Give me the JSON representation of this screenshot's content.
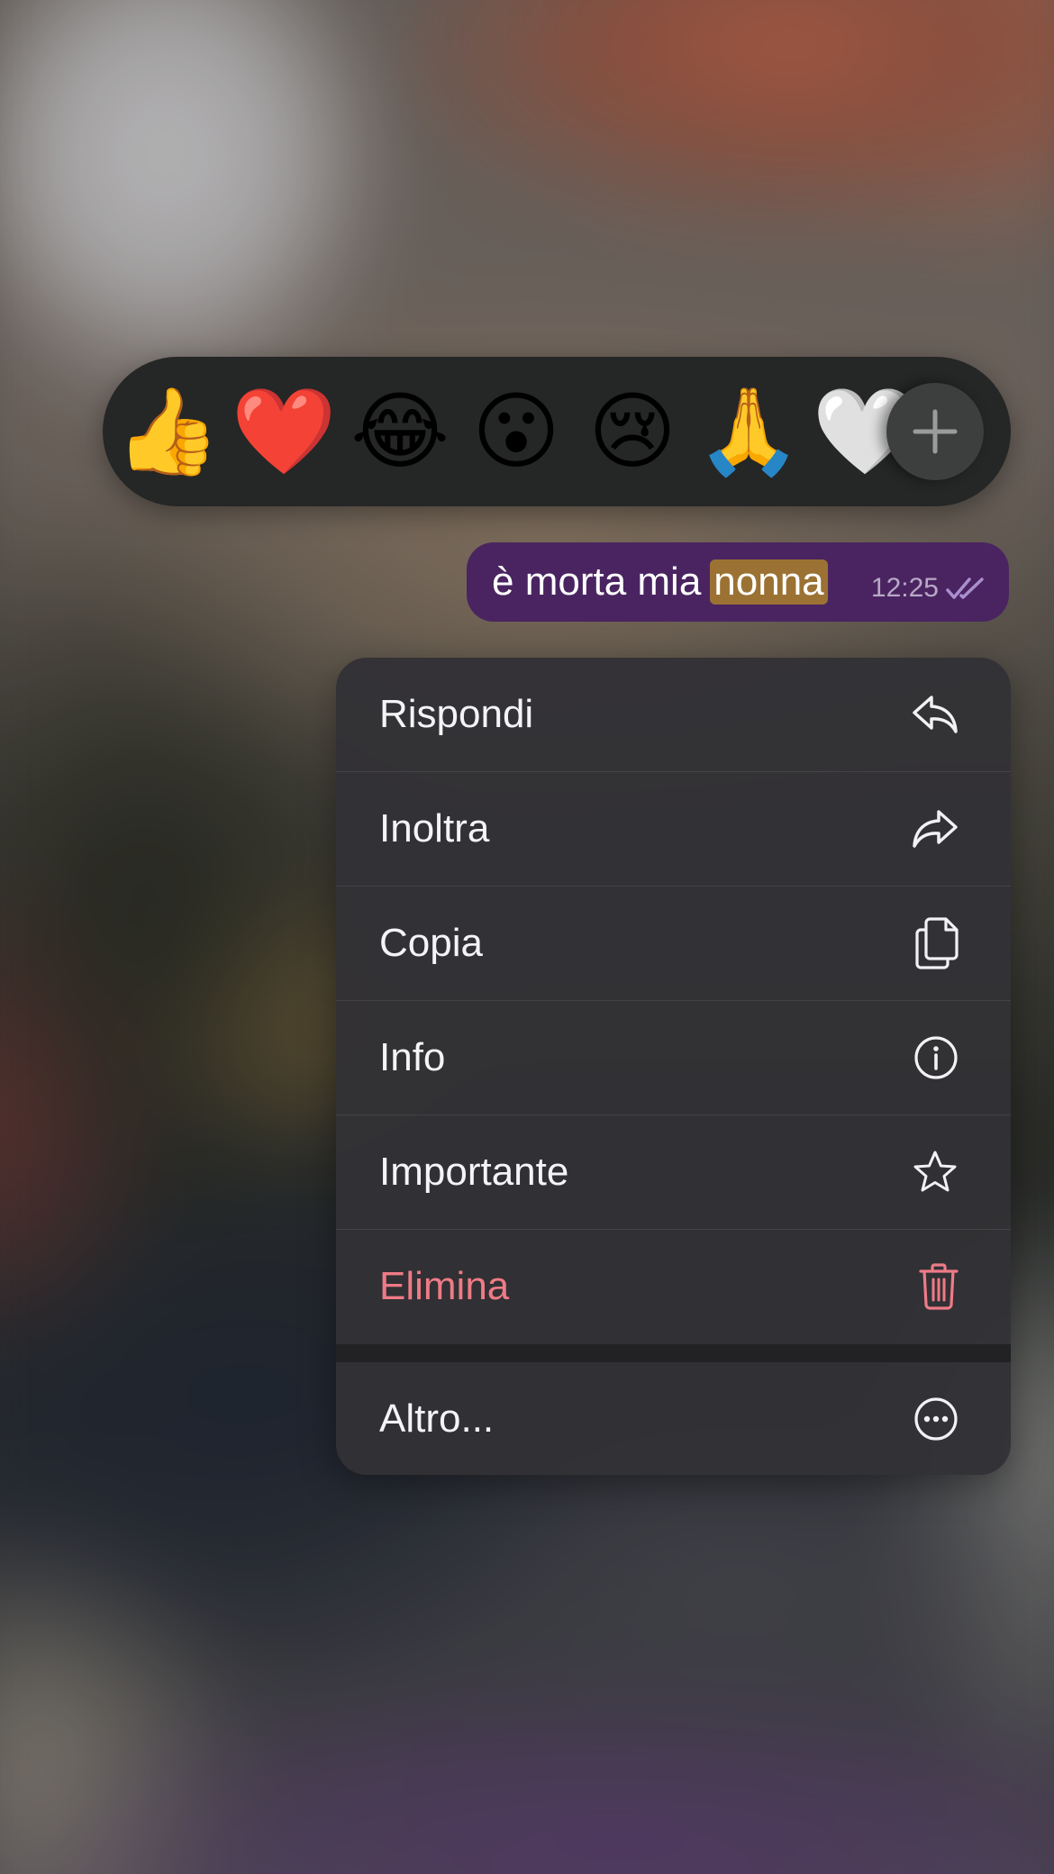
{
  "reactions": {
    "emojis": [
      {
        "icon": "thumbs-up",
        "glyph": "👍"
      },
      {
        "icon": "red-heart",
        "glyph": "❤️"
      },
      {
        "icon": "tears-of-joy",
        "glyph": "😂"
      },
      {
        "icon": "surprised-face",
        "glyph": "😮"
      },
      {
        "icon": "crying-face",
        "glyph": "😢"
      },
      {
        "icon": "folded-hands",
        "glyph": "🙏"
      },
      {
        "icon": "white-heart",
        "glyph": "🤍"
      }
    ],
    "more_icon": "plus-icon"
  },
  "message": {
    "text_before": "è morta mia",
    "highlighted": "nonna",
    "time": "12:25",
    "status_icon": "double-check-icon",
    "bubble_color": "#4a2460",
    "highlight_color": "#9b7233"
  },
  "menu": {
    "items": [
      {
        "label": "Rispondi",
        "icon": "reply-icon"
      },
      {
        "label": "Inoltra",
        "icon": "forward-icon"
      },
      {
        "label": "Copia",
        "icon": "copy-icon"
      },
      {
        "label": "Info",
        "icon": "info-icon"
      },
      {
        "label": "Importante",
        "icon": "star-icon"
      },
      {
        "label": "Elimina",
        "icon": "trash-icon",
        "color": "#ee7b86"
      }
    ],
    "more": {
      "label": "Altro...",
      "icon": "more-icon"
    }
  }
}
